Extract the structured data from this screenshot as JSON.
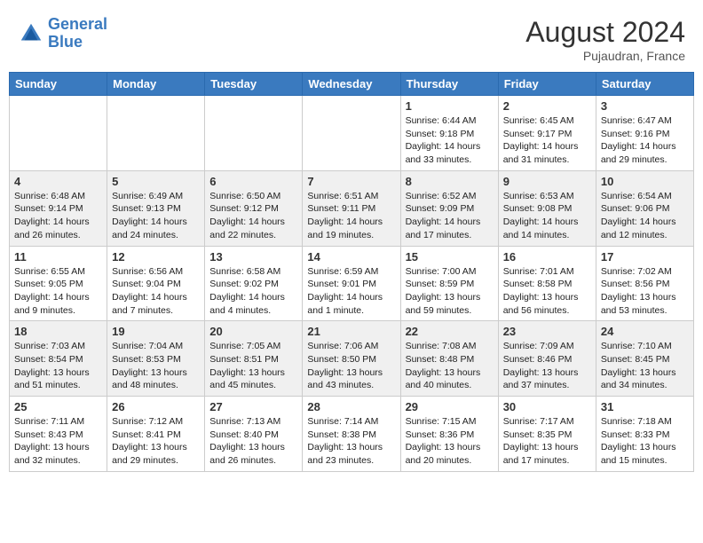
{
  "header": {
    "logo_line1": "General",
    "logo_line2": "Blue",
    "month_year": "August 2024",
    "location": "Pujaudran, France"
  },
  "weekdays": [
    "Sunday",
    "Monday",
    "Tuesday",
    "Wednesday",
    "Thursday",
    "Friday",
    "Saturday"
  ],
  "weeks": [
    {
      "shaded": false,
      "days": [
        {
          "num": "",
          "info": ""
        },
        {
          "num": "",
          "info": ""
        },
        {
          "num": "",
          "info": ""
        },
        {
          "num": "",
          "info": ""
        },
        {
          "num": "1",
          "info": "Sunrise: 6:44 AM\nSunset: 9:18 PM\nDaylight: 14 hours\nand 33 minutes."
        },
        {
          "num": "2",
          "info": "Sunrise: 6:45 AM\nSunset: 9:17 PM\nDaylight: 14 hours\nand 31 minutes."
        },
        {
          "num": "3",
          "info": "Sunrise: 6:47 AM\nSunset: 9:16 PM\nDaylight: 14 hours\nand 29 minutes."
        }
      ]
    },
    {
      "shaded": true,
      "days": [
        {
          "num": "4",
          "info": "Sunrise: 6:48 AM\nSunset: 9:14 PM\nDaylight: 14 hours\nand 26 minutes."
        },
        {
          "num": "5",
          "info": "Sunrise: 6:49 AM\nSunset: 9:13 PM\nDaylight: 14 hours\nand 24 minutes."
        },
        {
          "num": "6",
          "info": "Sunrise: 6:50 AM\nSunset: 9:12 PM\nDaylight: 14 hours\nand 22 minutes."
        },
        {
          "num": "7",
          "info": "Sunrise: 6:51 AM\nSunset: 9:11 PM\nDaylight: 14 hours\nand 19 minutes."
        },
        {
          "num": "8",
          "info": "Sunrise: 6:52 AM\nSunset: 9:09 PM\nDaylight: 14 hours\nand 17 minutes."
        },
        {
          "num": "9",
          "info": "Sunrise: 6:53 AM\nSunset: 9:08 PM\nDaylight: 14 hours\nand 14 minutes."
        },
        {
          "num": "10",
          "info": "Sunrise: 6:54 AM\nSunset: 9:06 PM\nDaylight: 14 hours\nand 12 minutes."
        }
      ]
    },
    {
      "shaded": false,
      "days": [
        {
          "num": "11",
          "info": "Sunrise: 6:55 AM\nSunset: 9:05 PM\nDaylight: 14 hours\nand 9 minutes."
        },
        {
          "num": "12",
          "info": "Sunrise: 6:56 AM\nSunset: 9:04 PM\nDaylight: 14 hours\nand 7 minutes."
        },
        {
          "num": "13",
          "info": "Sunrise: 6:58 AM\nSunset: 9:02 PM\nDaylight: 14 hours\nand 4 minutes."
        },
        {
          "num": "14",
          "info": "Sunrise: 6:59 AM\nSunset: 9:01 PM\nDaylight: 14 hours\nand 1 minute."
        },
        {
          "num": "15",
          "info": "Sunrise: 7:00 AM\nSunset: 8:59 PM\nDaylight: 13 hours\nand 59 minutes."
        },
        {
          "num": "16",
          "info": "Sunrise: 7:01 AM\nSunset: 8:58 PM\nDaylight: 13 hours\nand 56 minutes."
        },
        {
          "num": "17",
          "info": "Sunrise: 7:02 AM\nSunset: 8:56 PM\nDaylight: 13 hours\nand 53 minutes."
        }
      ]
    },
    {
      "shaded": true,
      "days": [
        {
          "num": "18",
          "info": "Sunrise: 7:03 AM\nSunset: 8:54 PM\nDaylight: 13 hours\nand 51 minutes."
        },
        {
          "num": "19",
          "info": "Sunrise: 7:04 AM\nSunset: 8:53 PM\nDaylight: 13 hours\nand 48 minutes."
        },
        {
          "num": "20",
          "info": "Sunrise: 7:05 AM\nSunset: 8:51 PM\nDaylight: 13 hours\nand 45 minutes."
        },
        {
          "num": "21",
          "info": "Sunrise: 7:06 AM\nSunset: 8:50 PM\nDaylight: 13 hours\nand 43 minutes."
        },
        {
          "num": "22",
          "info": "Sunrise: 7:08 AM\nSunset: 8:48 PM\nDaylight: 13 hours\nand 40 minutes."
        },
        {
          "num": "23",
          "info": "Sunrise: 7:09 AM\nSunset: 8:46 PM\nDaylight: 13 hours\nand 37 minutes."
        },
        {
          "num": "24",
          "info": "Sunrise: 7:10 AM\nSunset: 8:45 PM\nDaylight: 13 hours\nand 34 minutes."
        }
      ]
    },
    {
      "shaded": false,
      "days": [
        {
          "num": "25",
          "info": "Sunrise: 7:11 AM\nSunset: 8:43 PM\nDaylight: 13 hours\nand 32 minutes."
        },
        {
          "num": "26",
          "info": "Sunrise: 7:12 AM\nSunset: 8:41 PM\nDaylight: 13 hours\nand 29 minutes."
        },
        {
          "num": "27",
          "info": "Sunrise: 7:13 AM\nSunset: 8:40 PM\nDaylight: 13 hours\nand 26 minutes."
        },
        {
          "num": "28",
          "info": "Sunrise: 7:14 AM\nSunset: 8:38 PM\nDaylight: 13 hours\nand 23 minutes."
        },
        {
          "num": "29",
          "info": "Sunrise: 7:15 AM\nSunset: 8:36 PM\nDaylight: 13 hours\nand 20 minutes."
        },
        {
          "num": "30",
          "info": "Sunrise: 7:17 AM\nSunset: 8:35 PM\nDaylight: 13 hours\nand 17 minutes."
        },
        {
          "num": "31",
          "info": "Sunrise: 7:18 AM\nSunset: 8:33 PM\nDaylight: 13 hours\nand 15 minutes."
        }
      ]
    }
  ]
}
